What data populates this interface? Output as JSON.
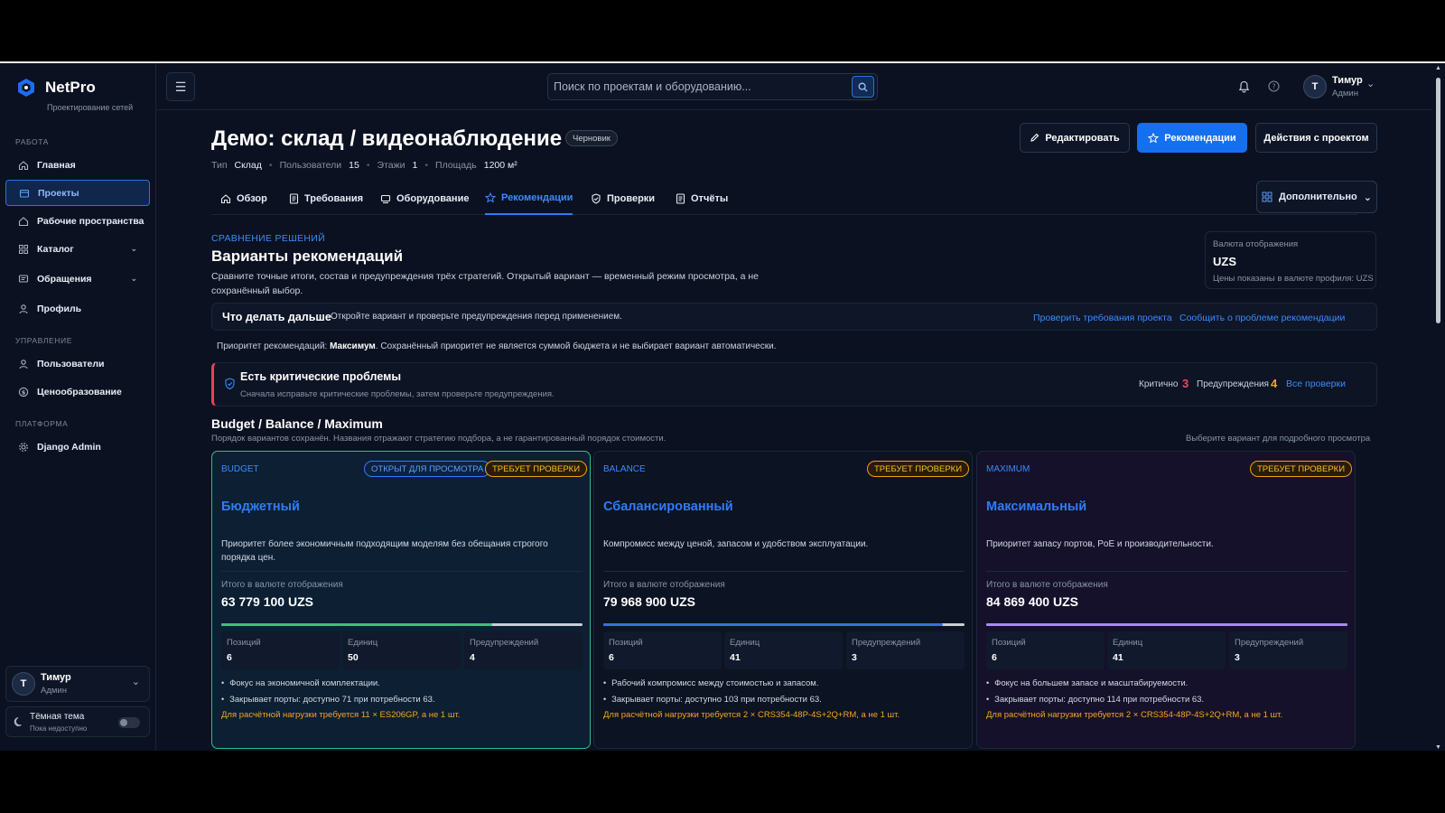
{
  "brand": {
    "name": "NetPro",
    "subtitle": "Проектирование сетей"
  },
  "sidebar": {
    "sections": [
      "РАБОТА",
      "УПРАВЛЕНИЕ",
      "ПЛАТФОРМА"
    ],
    "items": [
      {
        "label": "Главная",
        "icon": "home-icon"
      },
      {
        "label": "Проекты",
        "icon": "folder-icon",
        "active": true
      },
      {
        "label": "Рабочие пространства",
        "icon": "workspace-icon"
      },
      {
        "label": "Каталог",
        "icon": "grid-icon"
      },
      {
        "label": "Обращения",
        "icon": "message-icon"
      },
      {
        "label": "Профиль",
        "icon": "user-icon"
      },
      {
        "label": "Пользователи",
        "icon": "user-icon"
      },
      {
        "label": "Ценообразование",
        "icon": "currency-icon"
      },
      {
        "label": "Django Admin",
        "icon": "gear-icon"
      }
    ],
    "user": {
      "initial": "Т",
      "name": "Тимур",
      "role": "Админ"
    },
    "theme": {
      "label": "Тёмная тема",
      "note": "Пока недоступно"
    }
  },
  "topbar": {
    "search_placeholder": "Поиск по проектам и оборудованию...",
    "user": {
      "initial": "Т",
      "name": "Тимур",
      "role": "Админ"
    }
  },
  "project": {
    "title": "Демо: склад / видеонаблюдение",
    "status": "Черновик",
    "meta": {
      "type_label": "Тип",
      "type_value": "Склад",
      "users_label": "Пользователи",
      "users_value": "15",
      "floors_label": "Этажи",
      "floors_value": "1",
      "area_label": "Площадь",
      "area_value": "1200 м²"
    },
    "actions": {
      "edit": "Редактировать",
      "recommendations": "Рекомендации",
      "project_actions": "Действия с проектом"
    }
  },
  "tabs": [
    {
      "label": "Обзор"
    },
    {
      "label": "Требования"
    },
    {
      "label": "Оборудование"
    },
    {
      "label": "Рекомендации",
      "active": true
    },
    {
      "label": "Проверки"
    },
    {
      "label": "Отчёты"
    }
  ],
  "more_button": "Дополнительно",
  "compare": {
    "eyebrow": "СРАВНЕНИЕ РЕШЕНИЙ",
    "title": "Варианты рекомендаций",
    "description": "Сравните точные итоги, состав и предупреждения трёх стратегий. Открытый вариант — временный режим просмотра, а не сохранённый выбор."
  },
  "currency": {
    "label": "Валюта отображения",
    "value": "UZS",
    "note": "Цены показаны в валюте профиля: UZS"
  },
  "next_steps": {
    "title": "Что делать дальше",
    "description": "Откройте вариант и проверьте предупреждения перед применением.",
    "link1": "Проверить требования проекта",
    "link2": "Сообщить о проблеме рекомендации"
  },
  "priority": {
    "prefix": "Приоритет рекомендаций:",
    "value": "Максимум",
    "suffix": ". Сохранённый приоритет не является суммой бюджета и не выбирает вариант автоматически."
  },
  "critical": {
    "title": "Есть критические проблемы",
    "description": "Сначала исправьте критические проблемы, затем проверьте предупреждения.",
    "critical_label": "Критично",
    "critical_count": "3",
    "warnings_label": "Предупреждения",
    "warnings_count": "4",
    "all_checks": "Все проверки"
  },
  "variants_header": {
    "title": "Budget / Balance / Maximum",
    "subtitle": "Порядок вариантов сохранён. Названия отражают стратегию подбора, а не гарантированный порядок стоимости.",
    "hint": "Выберите вариант для подробного просмотра"
  },
  "variants": [
    {
      "code": "BUDGET",
      "open_badge": "ОТКРЫТ ДЛЯ ПРОСМОТРА",
      "status": "ТРЕБУЕТ ПРОВЕРКИ",
      "name": "Бюджетный",
      "description": "Приоритет более экономичным подходящим моделям без обещания строгого порядка цен.",
      "total_label": "Итого в валюте отображения",
      "total": "63 779 100 UZS",
      "bar_fraction": 0.75,
      "bar_color": "#3fbf7f",
      "positions_label": "Позиций",
      "positions": "6",
      "units_label": "Единиц",
      "units": "50",
      "warnings_label": "Предупреждений",
      "warnings": "4",
      "bullets": [
        "Фокус на экономичной комплектации.",
        "Закрывает порты: доступно 71 при потребности 63."
      ],
      "warning": "Для расчётной нагрузки требуется 11 × ES206GP, а не 1 шт."
    },
    {
      "code": "BALANCE",
      "status": "ТРЕБУЕТ ПРОВЕРКИ",
      "name": "Сбалансированный",
      "description": "Компромисс между ценой, запасом и удобством эксплуатации.",
      "total_label": "Итого в валюте отображения",
      "total": "79 968 900 UZS",
      "bar_fraction": 0.94,
      "bar_color": "#3b6fe0",
      "positions_label": "Позиций",
      "positions": "6",
      "units_label": "Единиц",
      "units": "41",
      "warnings_label": "Предупреждений",
      "warnings": "3",
      "bullets": [
        "Рабочий компромисс между стоимостью и запасом.",
        "Закрывает порты: доступно 103 при потребности 63."
      ],
      "warning": "Для расчётной нагрузки требуется 2 × CRS354-48P-4S+2Q+RM, а не 1 шт."
    },
    {
      "code": "MAXIMUM",
      "status": "ТРЕБУЕТ ПРОВЕРКИ",
      "name": "Максимальный",
      "description": "Приоритет запасу портов, PoE и производительности.",
      "total_label": "Итого в валюте отображения",
      "total": "84 869 400 UZS",
      "bar_fraction": 1.0,
      "bar_color": "#a98af0",
      "positions_label": "Позиций",
      "positions": "6",
      "units_label": "Единиц",
      "units": "41",
      "warnings_label": "Предупреждений",
      "warnings": "3",
      "bullets": [
        "Фокус на большем запасе и масштабируемости.",
        "Закрывает порты: доступно 114 при потребности 63."
      ],
      "warning": "Для расчётной нагрузки требуется 2 × CRS354-48P-4S+2Q+RM, а не 1 шт."
    }
  ]
}
